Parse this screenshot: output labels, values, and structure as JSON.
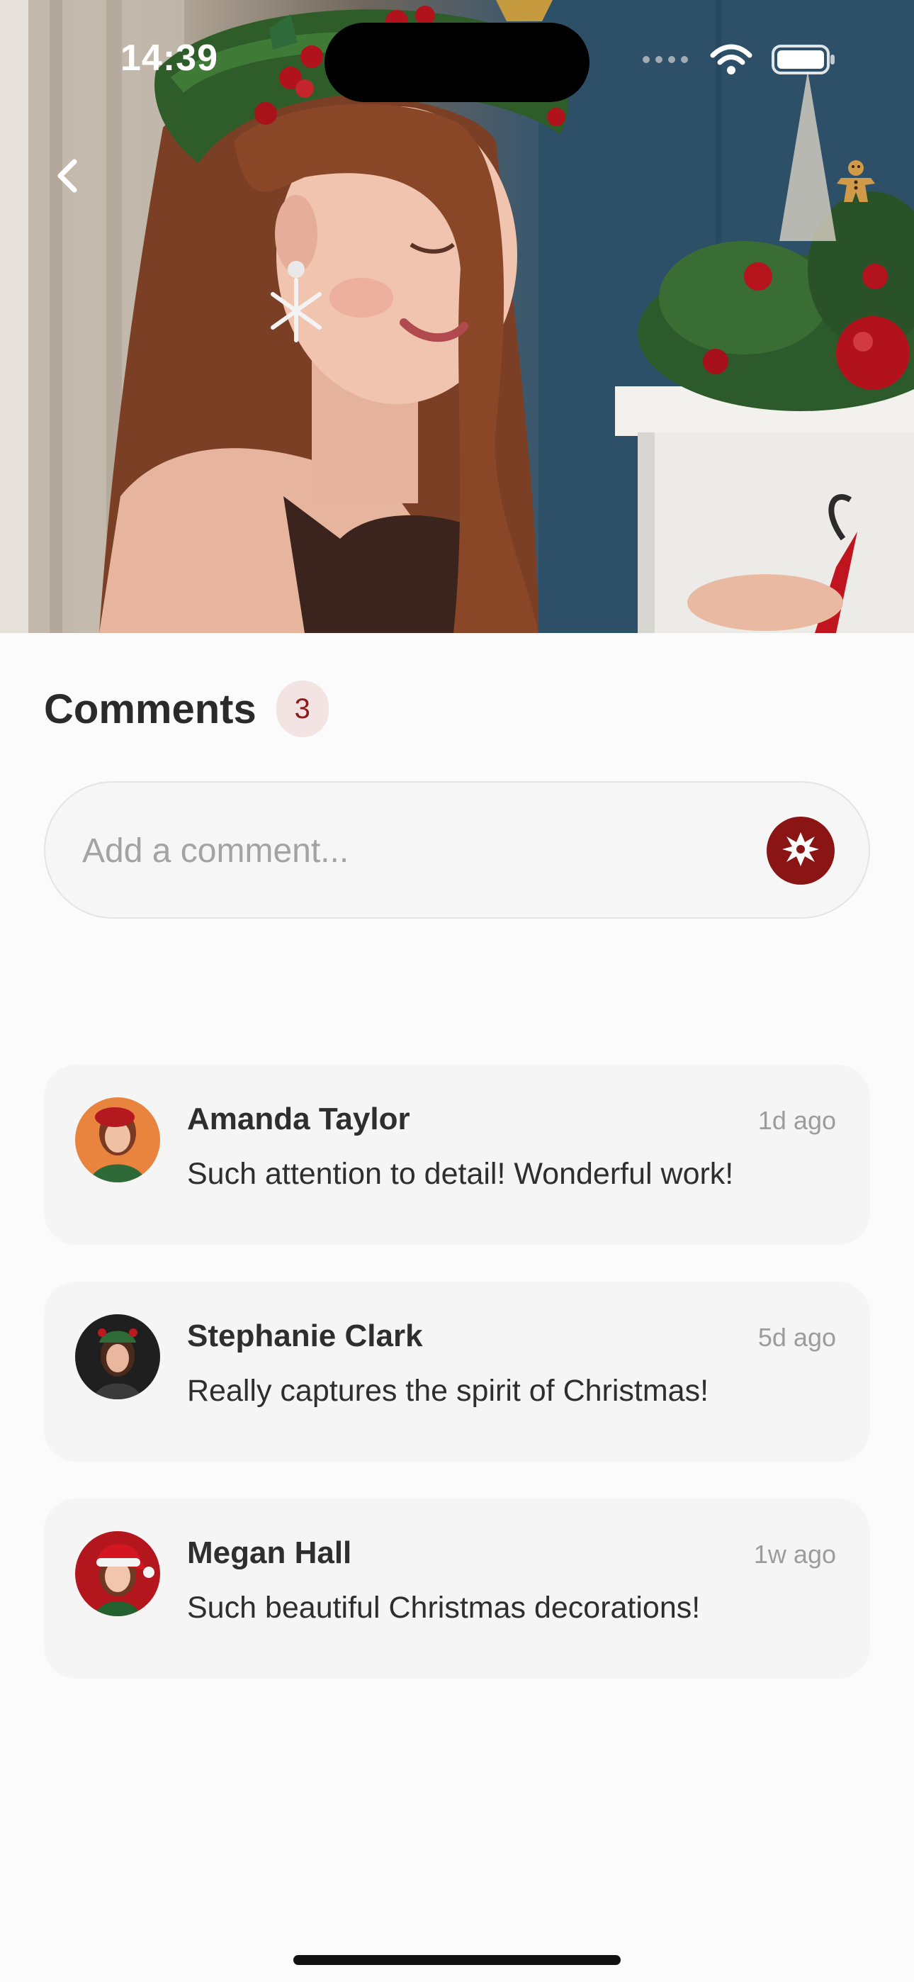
{
  "status_bar": {
    "time": "14:39",
    "icons": [
      "signal-icon",
      "wifi-icon",
      "battery-icon"
    ]
  },
  "hero": {
    "description_icons": [
      "back-chevron-icon",
      "gingerbread-icon"
    ]
  },
  "comments": {
    "title": "Comments",
    "count": "3",
    "input_placeholder": "Add a comment...",
    "input_value": "",
    "send_icon": "snowflake-icon",
    "items": [
      {
        "author": "Amanda Taylor",
        "time": "1d ago",
        "text": "Such attention to detail! Wonderful work!"
      },
      {
        "author": "Stephanie Clark",
        "time": "5d ago",
        "text": "Really captures the spirit of Christmas!"
      },
      {
        "author": "Megan Hall",
        "time": "1w ago",
        "text": "Such beautiful Christmas decorations!"
      }
    ]
  },
  "colors": {
    "accent": "#8b1414",
    "badge_bg": "#f3e3e3",
    "card_bg": "#f5f5f5",
    "page_bg": "#fbfbfb"
  }
}
